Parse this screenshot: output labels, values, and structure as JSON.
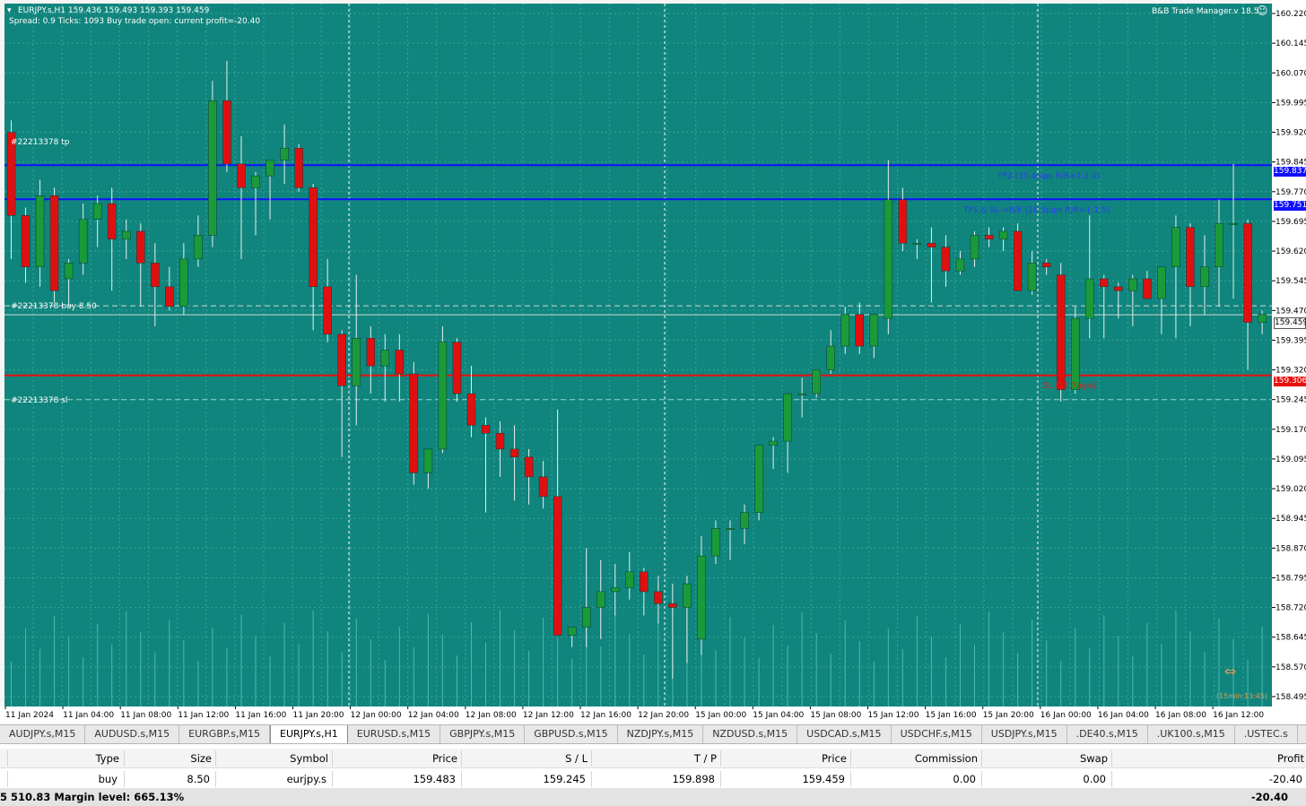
{
  "colors": {
    "chart_bg": "#10857d",
    "grid": "#3aa49c",
    "bull": "#1a9a38",
    "bear": "#e01010",
    "wick": "#e8f0ef",
    "blue_line": "#1010ff",
    "red_line": "#e81010",
    "axis_bg": "#ffffff"
  },
  "chart": {
    "info_line1": "EURJPY.s,H1  159.436 159.493 159.393 159.459",
    "info_line2": "Spread: 0.9  Ticks: 1093  Buy trade open: current profit=-20.40",
    "ea_title": "B&B Trade Manager.v 18.5",
    "price_labels": [
      "160.220",
      "160.145",
      "160.070",
      "159.995",
      "159.920",
      "159.845",
      "159.770",
      "159.695",
      "159.620",
      "159.545",
      "159.470",
      "159.395",
      "159.320",
      "159.245",
      "159.170",
      "159.095",
      "159.020",
      "158.945",
      "158.870",
      "158.795",
      "158.720",
      "158.645",
      "158.570",
      "158.495"
    ],
    "time_labels": [
      "11 Jan 2024",
      "11 Jan 04:00",
      "11 Jan 08:00",
      "11 Jan 12:00",
      "11 Jan 16:00",
      "11 Jan 20:00",
      "12 Jan 00:00",
      "12 Jan 04:00",
      "12 Jan 08:00",
      "12 Jan 12:00",
      "12 Jan 16:00",
      "12 Jan 20:00",
      "15 Jan 00:00",
      "15 Jan 04:00",
      "15 Jan 08:00",
      "15 Jan 12:00",
      "15 Jan 16:00",
      "15 Jan 20:00",
      "16 Jan 00:00",
      "16 Jan 04:00",
      "16 Jan 08:00",
      "16 Jan 12:00"
    ],
    "order_tp_label": "#22213378 tp",
    "order_buy_label": "#22213378 buy 8.50",
    "order_sl_label": "#22213378 sl",
    "tp2_text": "TP2 (35.4pips R/R=1:2.0)",
    "tp1_text": "TP1 & SL->B/E (26.5pips R/R=1:1.5)",
    "sl_text": "SL (17.7pips)",
    "tp2_price": "159.837",
    "tp1_price": "159.751",
    "current_price": "159.459",
    "sl_price": "159.306",
    "timer_text": "(15min 13:45)"
  },
  "tabs": [
    {
      "label": "AUDJPY.s,M15",
      "active": false
    },
    {
      "label": "AUDUSD.s,M15",
      "active": false
    },
    {
      "label": "EURGBP.s,M15",
      "active": false
    },
    {
      "label": "EURJPY.s,H1",
      "active": true
    },
    {
      "label": "EURUSD.s,M15",
      "active": false
    },
    {
      "label": "GBPJPY.s,M15",
      "active": false
    },
    {
      "label": "GBPUSD.s,M15",
      "active": false
    },
    {
      "label": "NZDJPY.s,M15",
      "active": false
    },
    {
      "label": "NZDUSD.s,M15",
      "active": false
    },
    {
      "label": "USDCAD.s,M15",
      "active": false
    },
    {
      "label": "USDCHF.s,M15",
      "active": false
    },
    {
      "label": "USDJPY.s,M15",
      "active": false
    },
    {
      "label": ".DE40.s,M15",
      "active": false
    },
    {
      "label": ".UK100.s,M15",
      "active": false
    },
    {
      "label": ".USTEC.s",
      "active": false
    }
  ],
  "terminal": {
    "columns": [
      "Type",
      "Size",
      "Symbol",
      "Price",
      "S / L",
      "T / P",
      "Price",
      "Commission",
      "Swap",
      "Profit"
    ],
    "trade": [
      "buy",
      "8.50",
      "eurjpy.s",
      "159.483",
      "159.245",
      "159.898",
      "159.459",
      "0.00",
      "0.00",
      "-20.40"
    ],
    "status_left": "5 510.83  Margin level: 665.13%",
    "status_profit": "-20.40"
  },
  "candles": [
    [
      159.92,
      159.95,
      159.6,
      159.71
    ],
    [
      159.71,
      159.73,
      159.54,
      159.58
    ],
    [
      159.58,
      159.8,
      159.53,
      159.76
    ],
    [
      159.76,
      159.78,
      159.49,
      159.52
    ],
    [
      159.55,
      159.6,
      159.48,
      159.59
    ],
    [
      159.59,
      159.74,
      159.56,
      159.7
    ],
    [
      159.7,
      159.76,
      159.63,
      159.74
    ],
    [
      159.74,
      159.78,
      159.52,
      159.65
    ],
    [
      159.65,
      159.7,
      159.6,
      159.67
    ],
    [
      159.67,
      159.69,
      159.48,
      159.59
    ],
    [
      159.59,
      159.64,
      159.43,
      159.53
    ],
    [
      159.53,
      159.58,
      159.47,
      159.48
    ],
    [
      159.48,
      159.64,
      159.46,
      159.6
    ],
    [
      159.6,
      159.71,
      159.58,
      159.66
    ],
    [
      159.66,
      160.05,
      159.63,
      160.0
    ],
    [
      160.0,
      160.1,
      159.82,
      159.84
    ],
    [
      159.84,
      159.91,
      159.6,
      159.78
    ],
    [
      159.78,
      159.82,
      159.66,
      159.81
    ],
    [
      159.81,
      159.85,
      159.7,
      159.85
    ],
    [
      159.85,
      159.94,
      159.79,
      159.88
    ],
    [
      159.88,
      159.89,
      159.77,
      159.78
    ],
    [
      159.78,
      159.79,
      159.42,
      159.53
    ],
    [
      159.53,
      159.6,
      159.39,
      159.41
    ],
    [
      159.41,
      159.42,
      159.1,
      159.28
    ],
    [
      159.28,
      159.56,
      159.18,
      159.4
    ],
    [
      159.4,
      159.43,
      159.26,
      159.33
    ],
    [
      159.33,
      159.41,
      159.24,
      159.37
    ],
    [
      159.37,
      159.41,
      159.24,
      159.31
    ],
    [
      159.31,
      159.34,
      159.03,
      159.06
    ],
    [
      159.06,
      159.12,
      159.02,
      159.12
    ],
    [
      159.12,
      159.43,
      159.11,
      159.39
    ],
    [
      159.39,
      159.4,
      159.24,
      159.26
    ],
    [
      159.26,
      159.33,
      159.15,
      159.18
    ],
    [
      159.18,
      159.2,
      158.96,
      159.16
    ],
    [
      159.16,
      159.19,
      159.05,
      159.12
    ],
    [
      159.12,
      159.18,
      158.99,
      159.1
    ],
    [
      159.1,
      159.12,
      158.98,
      159.05
    ],
    [
      159.05,
      159.09,
      158.97,
      159.0
    ],
    [
      159.0,
      159.22,
      158.85,
      158.65
    ],
    [
      158.65,
      158.67,
      158.62,
      158.67
    ],
    [
      158.67,
      158.87,
      158.62,
      158.72
    ],
    [
      158.72,
      158.84,
      158.64,
      158.76
    ],
    [
      158.76,
      158.83,
      158.7,
      158.77
    ],
    [
      158.77,
      158.86,
      158.74,
      158.81
    ],
    [
      158.81,
      158.82,
      158.7,
      158.76
    ],
    [
      158.76,
      158.8,
      158.68,
      158.73
    ],
    [
      158.73,
      158.78,
      158.54,
      158.72
    ],
    [
      158.72,
      158.8,
      158.58,
      158.78
    ],
    [
      158.64,
      158.9,
      158.6,
      158.85
    ],
    [
      158.85,
      158.94,
      158.83,
      158.92
    ],
    [
      158.92,
      158.94,
      158.84,
      158.92
    ],
    [
      158.92,
      158.98,
      158.88,
      158.96
    ],
    [
      158.96,
      159.13,
      158.94,
      159.13
    ],
    [
      159.13,
      159.15,
      159.07,
      159.14
    ],
    [
      159.14,
      159.26,
      159.06,
      159.26
    ],
    [
      159.26,
      159.3,
      159.2,
      159.26
    ],
    [
      159.26,
      159.3,
      159.25,
      159.32
    ],
    [
      159.32,
      159.42,
      159.31,
      159.38
    ],
    [
      159.38,
      159.48,
      159.36,
      159.46
    ],
    [
      159.46,
      159.49,
      159.36,
      159.38
    ],
    [
      159.38,
      159.46,
      159.35,
      159.46
    ],
    [
      159.45,
      159.85,
      159.41,
      159.75
    ],
    [
      159.75,
      159.78,
      159.62,
      159.64
    ],
    [
      159.64,
      159.65,
      159.6,
      159.64
    ],
    [
      159.64,
      159.68,
      159.49,
      159.63
    ],
    [
      159.63,
      159.66,
      159.53,
      159.57
    ],
    [
      159.57,
      159.62,
      159.56,
      159.6
    ],
    [
      159.6,
      159.67,
      159.58,
      159.66
    ],
    [
      159.66,
      159.68,
      159.63,
      159.65
    ],
    [
      159.65,
      159.68,
      159.62,
      159.67
    ],
    [
      159.67,
      159.69,
      159.54,
      159.52
    ],
    [
      159.52,
      159.62,
      159.51,
      159.59
    ],
    [
      159.59,
      159.6,
      159.56,
      159.58
    ],
    [
      159.56,
      159.59,
      159.24,
      159.27
    ],
    [
      159.27,
      159.48,
      159.26,
      159.45
    ],
    [
      159.45,
      159.71,
      159.4,
      159.55
    ],
    [
      159.55,
      159.56,
      159.4,
      159.53
    ],
    [
      159.53,
      159.54,
      159.45,
      159.52
    ],
    [
      159.52,
      159.56,
      159.43,
      159.55
    ],
    [
      159.55,
      159.57,
      159.5,
      159.5
    ],
    [
      159.5,
      159.58,
      159.41,
      159.58
    ],
    [
      159.58,
      159.71,
      159.4,
      159.68
    ],
    [
      159.68,
      159.69,
      159.43,
      159.53
    ],
    [
      159.53,
      159.66,
      159.46,
      159.58
    ],
    [
      159.58,
      159.75,
      159.48,
      159.69
    ],
    [
      159.69,
      159.84,
      159.5,
      159.69
    ],
    [
      159.69,
      159.7,
      159.32,
      159.44
    ],
    [
      159.44,
      159.47,
      159.41,
      159.46
    ]
  ]
}
